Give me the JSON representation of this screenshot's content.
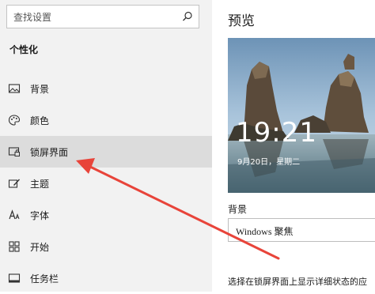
{
  "sidebar": {
    "search": {
      "placeholder": "查找设置"
    },
    "section_title": "个性化",
    "items": [
      {
        "label": "背景",
        "icon": "picture-icon"
      },
      {
        "label": "颜色",
        "icon": "palette-icon"
      },
      {
        "label": "锁屏界面",
        "icon": "lock-screen-icon",
        "active": true
      },
      {
        "label": "主题",
        "icon": "theme-brush-icon"
      },
      {
        "label": "字体",
        "icon": "font-icon"
      },
      {
        "label": "开始",
        "icon": "start-grid-icon"
      },
      {
        "label": "任务栏",
        "icon": "taskbar-icon"
      }
    ]
  },
  "main": {
    "title": "预览",
    "preview": {
      "time": "19:21",
      "date": "9月20日，星期二"
    },
    "background_label": "背景",
    "background_value": "Windows 聚焦",
    "description": "选择在锁屏界面上显示详细状态的应"
  },
  "colors": {
    "annotation_arrow": "#e8443a",
    "active_item_bg": "#dcdcdc",
    "sidebar_bg": "#f2f2f2"
  }
}
